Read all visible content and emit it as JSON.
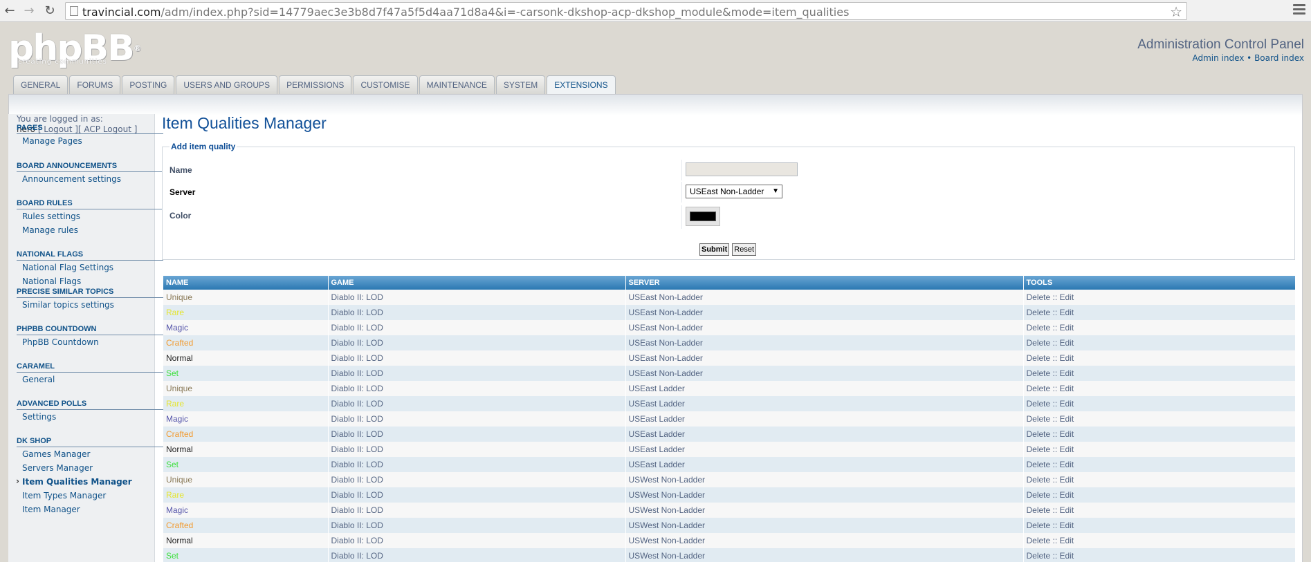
{
  "browser": {
    "url_host": "travincial.com",
    "url_rest": "/adm/index.php?sid=14779aec3e3b8d7f47a5f5d4aa71d8a4&i=-carsonk-dkshop-acp-dkshop_module&mode=item_qualities"
  },
  "header": {
    "logo": "phpBB",
    "logo_tagline": "creating   communities",
    "title": "Administration Control Panel",
    "admin_index": "Admin index",
    "sep": " • ",
    "board_index": "Board index"
  },
  "tabs": [
    {
      "label": "GENERAL"
    },
    {
      "label": "FORUMS"
    },
    {
      "label": "POSTING"
    },
    {
      "label": "USERS AND GROUPS"
    },
    {
      "label": "PERMISSIONS"
    },
    {
      "label": "CUSTOMISE"
    },
    {
      "label": "MAINTENANCE"
    },
    {
      "label": "SYSTEM"
    },
    {
      "label": "EXTENSIONS",
      "active": true
    }
  ],
  "login": {
    "text": "You are logged in as:",
    "user": "nero",
    "links": " [ Logout ][ ACP Logout ]"
  },
  "sidebar": [
    {
      "head": "PAGES",
      "items": [
        "Manage Pages"
      ]
    },
    {
      "head": "BOARD ANNOUNCEMENTS",
      "items": [
        "Announcement settings"
      ]
    },
    {
      "head": "BOARD RULES",
      "items": [
        "Rules settings",
        "Manage rules"
      ]
    },
    {
      "head": "NATIONAL FLAGS",
      "items": [
        "National Flag Settings",
        "National Flags"
      ]
    },
    {
      "head": "PRECISE SIMILAR TOPICS",
      "items": [
        "Similar topics settings"
      ]
    },
    {
      "head": "PHPBB COUNTDOWN",
      "items": [
        "PhpBB Countdown"
      ]
    },
    {
      "head": "CARAMEL",
      "items": [
        "General"
      ]
    },
    {
      "head": "ADVANCED POLLS",
      "items": [
        "Settings"
      ]
    },
    {
      "head": "DK SHOP",
      "items": [
        "Games Manager",
        "Servers Manager",
        "Item Qualities Manager",
        "Item Types Manager",
        "Item Manager"
      ]
    }
  ],
  "content": {
    "title": "Item Qualities Manager",
    "form": {
      "legend": "Add item quality",
      "name_label": "Name",
      "name_value": "",
      "server_label": "Server",
      "server_value": "USEast Non-Ladder",
      "color_label": "Color",
      "color_value": "#000000",
      "submit": "Submit",
      "reset": "Reset"
    },
    "table": {
      "headers": [
        "NAME",
        "GAME",
        "SERVER",
        "TOOLS"
      ],
      "tools": "Delete :: Edit",
      "rows": [
        {
          "name": "Unique",
          "color": "#8a7a58",
          "game": "Diablo II: LOD",
          "server": "USEast Non-Ladder"
        },
        {
          "name": "Rare",
          "color": "#e5e52e",
          "game": "Diablo II: LOD",
          "server": "USEast Non-Ladder"
        },
        {
          "name": "Magic",
          "color": "#5555aa",
          "game": "Diablo II: LOD",
          "server": "USEast Non-Ladder"
        },
        {
          "name": "Crafted",
          "color": "#f29a2e",
          "game": "Diablo II: LOD",
          "server": "USEast Non-Ladder"
        },
        {
          "name": "Normal",
          "color": "#222222",
          "game": "Diablo II: LOD",
          "server": "USEast Non-Ladder"
        },
        {
          "name": "Set",
          "color": "#3de03d",
          "game": "Diablo II: LOD",
          "server": "USEast Non-Ladder"
        },
        {
          "name": "Unique",
          "color": "#8a7a58",
          "game": "Diablo II: LOD",
          "server": "USEast Ladder"
        },
        {
          "name": "Rare",
          "color": "#e5e52e",
          "game": "Diablo II: LOD",
          "server": "USEast Ladder"
        },
        {
          "name": "Magic",
          "color": "#5555aa",
          "game": "Diablo II: LOD",
          "server": "USEast Ladder"
        },
        {
          "name": "Crafted",
          "color": "#f29a2e",
          "game": "Diablo II: LOD",
          "server": "USEast Ladder"
        },
        {
          "name": "Normal",
          "color": "#222222",
          "game": "Diablo II: LOD",
          "server": "USEast Ladder"
        },
        {
          "name": "Set",
          "color": "#3de03d",
          "game": "Diablo II: LOD",
          "server": "USEast Ladder"
        },
        {
          "name": "Unique",
          "color": "#8a7a58",
          "game": "Diablo II: LOD",
          "server": "USWest Non-Ladder"
        },
        {
          "name": "Rare",
          "color": "#e5e52e",
          "game": "Diablo II: LOD",
          "server": "USWest Non-Ladder"
        },
        {
          "name": "Magic",
          "color": "#5555aa",
          "game": "Diablo II: LOD",
          "server": "USWest Non-Ladder"
        },
        {
          "name": "Crafted",
          "color": "#f29a2e",
          "game": "Diablo II: LOD",
          "server": "USWest Non-Ladder"
        },
        {
          "name": "Normal",
          "color": "#222222",
          "game": "Diablo II: LOD",
          "server": "USWest Non-Ladder"
        },
        {
          "name": "Set",
          "color": "#3de03d",
          "game": "Diablo II: LOD",
          "server": "USWest Non-Ladder"
        }
      ]
    }
  }
}
